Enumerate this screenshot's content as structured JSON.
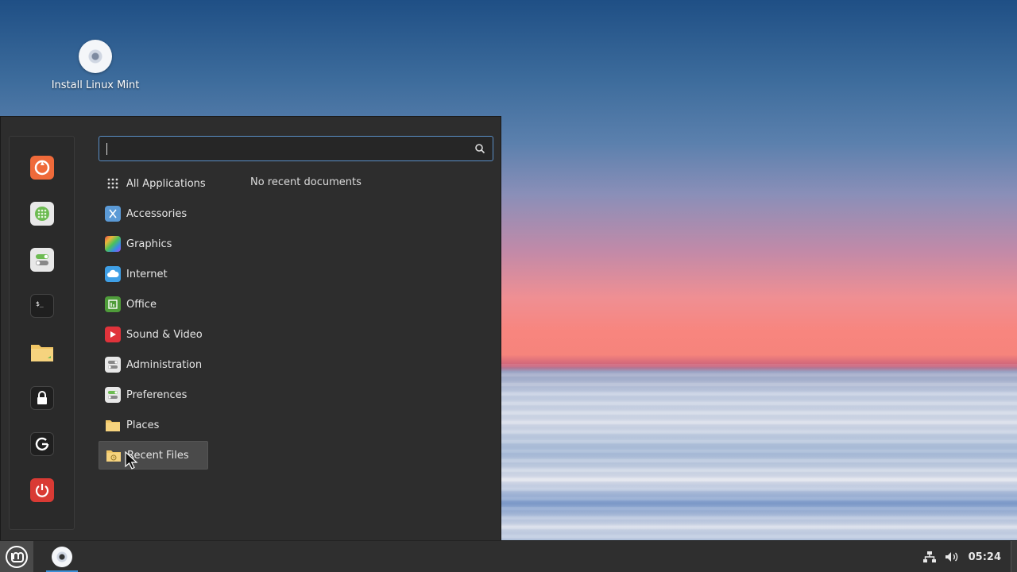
{
  "desktop": {
    "icons": [
      {
        "label": "Install Linux Mint",
        "icon": "disc-icon"
      }
    ]
  },
  "menu": {
    "search": {
      "value": "",
      "placeholder": ""
    },
    "favorites": [
      {
        "name": "firefox",
        "icon": "firefox-icon",
        "color": "#ef6a3a"
      },
      {
        "name": "software-manager",
        "icon": "grid-icon",
        "color": "#6dbb52"
      },
      {
        "name": "settings",
        "icon": "toggles-icon",
        "color": "#6dbb52"
      },
      {
        "name": "terminal",
        "icon": "terminal-icon",
        "color": "#1f1f1f"
      },
      {
        "name": "files",
        "icon": "folder-icon",
        "color": "#f1c665"
      },
      {
        "name": "lock-screen",
        "icon": "lock-icon",
        "color": "#1f1f1f"
      },
      {
        "name": "logout",
        "icon": "logout-icon",
        "color": "#1f1f1f"
      },
      {
        "name": "shutdown",
        "icon": "power-icon",
        "color": "#d93a34"
      }
    ],
    "categories": [
      {
        "label": "All Applications",
        "icon": "apps-grid-icon"
      },
      {
        "label": "Accessories",
        "icon": "accessories-icon"
      },
      {
        "label": "Graphics",
        "icon": "graphics-icon"
      },
      {
        "label": "Internet",
        "icon": "internet-icon"
      },
      {
        "label": "Office",
        "icon": "office-icon"
      },
      {
        "label": "Sound & Video",
        "icon": "sound-video-icon"
      },
      {
        "label": "Administration",
        "icon": "administration-icon"
      },
      {
        "label": "Preferences",
        "icon": "preferences-icon"
      },
      {
        "label": "Places",
        "icon": "places-icon"
      },
      {
        "label": "Recent Files",
        "icon": "recent-files-icon",
        "active": true
      }
    ],
    "recent_message": "No recent documents"
  },
  "panel": {
    "clock": "05:24",
    "accent": "#3d8fd6"
  }
}
